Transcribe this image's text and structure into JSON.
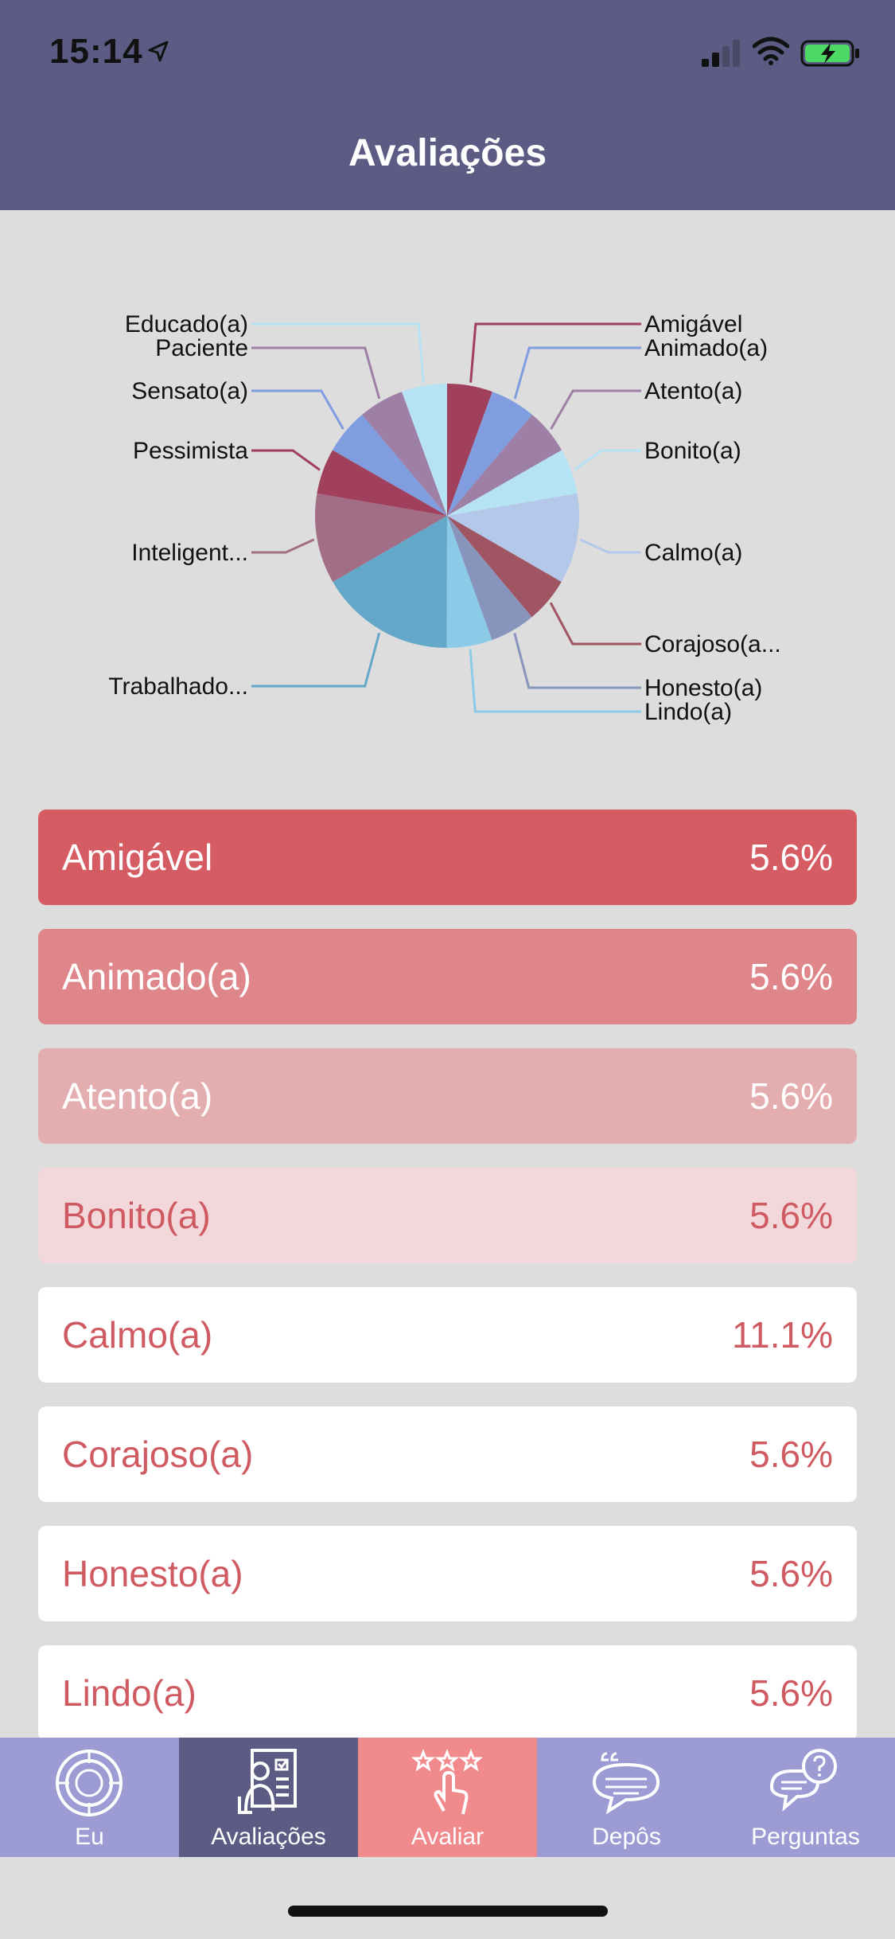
{
  "status": {
    "time": "15:14"
  },
  "nav": {
    "title": "Avaliações"
  },
  "chart_data": {
    "type": "pie",
    "title": "",
    "slices": [
      {
        "label": "Amigável",
        "value": 5.6,
        "color": "#a0405c"
      },
      {
        "label": "Animado(a)",
        "value": 5.6,
        "color": "#7f9ddf"
      },
      {
        "label": "Atento(a)",
        "value": 5.6,
        "color": "#9e7fa6"
      },
      {
        "label": "Bonito(a)",
        "value": 5.6,
        "color": "#b5e3f3"
      },
      {
        "label": "Calmo(a)",
        "value": 11.1,
        "color": "#b4c9e9"
      },
      {
        "label": "Corajoso(a...",
        "value": 5.6,
        "color": "#9f5562"
      },
      {
        "label": "Honesto(a)",
        "value": 5.6,
        "color": "#8795bd"
      },
      {
        "label": "Lindo(a)",
        "value": 5.6,
        "color": "#8ccbe8"
      },
      {
        "label": "Trabalhado...",
        "value": 16.7,
        "color": "#64a8c9"
      },
      {
        "label": "Inteligent...",
        "value": 11.1,
        "color": "#a26e86"
      },
      {
        "label": "Pessimista",
        "value": 5.6,
        "color": "#a0405c"
      },
      {
        "label": "Sensato(a)",
        "value": 5.6,
        "color": "#7f9ddf"
      },
      {
        "label": "Paciente",
        "value": 5.6,
        "color": "#9e7fa6"
      },
      {
        "label": "Educado(a)",
        "value": 5.6,
        "color": "#b5e3f3"
      }
    ]
  },
  "ranking": [
    {
      "label": "Amigável",
      "pct": "5.6%",
      "bg": "#d65c64",
      "fg": "#ffffff"
    },
    {
      "label": "Animado(a)",
      "pct": "5.6%",
      "bg": "#df868b",
      "fg": "#ffffff"
    },
    {
      "label": "Atento(a)",
      "pct": "5.6%",
      "bg": "#e4adaf",
      "fg": "#ffffff"
    },
    {
      "label": "Bonito(a)",
      "pct": "5.6%",
      "bg": "#f2d8da",
      "fg": "#d05a62"
    },
    {
      "label": "Calmo(a)",
      "pct": "11.1%",
      "bg": "#ffffff",
      "fg": "#d05a62"
    },
    {
      "label": "Corajoso(a)",
      "pct": "5.6%",
      "bg": "#ffffff",
      "fg": "#d05a62"
    },
    {
      "label": "Honesto(a)",
      "pct": "5.6%",
      "bg": "#ffffff",
      "fg": "#d05a62"
    },
    {
      "label": "Lindo(a)",
      "pct": "5.6%",
      "bg": "#ffffff",
      "fg": "#d05a62"
    }
  ],
  "tabs": [
    {
      "label": "Eu",
      "icon": "target-icon",
      "active": false
    },
    {
      "label": "Avaliações",
      "icon": "clipboard-person-icon",
      "active": true
    },
    {
      "label": "Avaliar",
      "icon": "stars-hand-icon",
      "active": false
    },
    {
      "label": "Depôs",
      "icon": "quote-bubble-icon",
      "active": false
    },
    {
      "label": "Perguntas",
      "icon": "question-bubble-icon",
      "active": false
    }
  ],
  "colors": {
    "header": "#5c5b83",
    "tab_bar": "#9d9bd3",
    "tab_active": "#5c5b83",
    "tab_highlight": "#f08a8c",
    "background": "#dddddd"
  }
}
